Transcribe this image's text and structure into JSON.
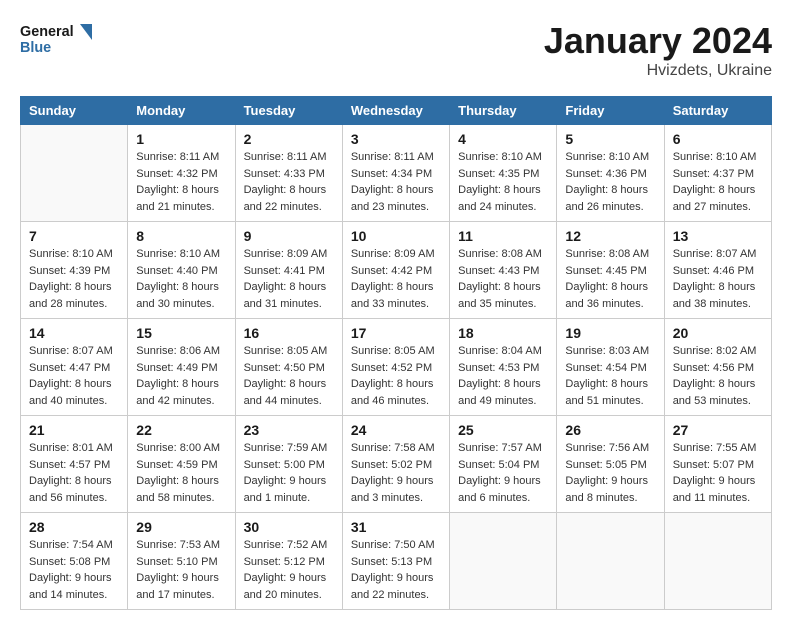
{
  "header": {
    "logo_line1": "General",
    "logo_line2": "Blue",
    "month": "January 2024",
    "location": "Hvizdets, Ukraine"
  },
  "weekdays": [
    "Sunday",
    "Monday",
    "Tuesday",
    "Wednesday",
    "Thursday",
    "Friday",
    "Saturday"
  ],
  "weeks": [
    [
      {
        "day": "",
        "sunrise": "",
        "sunset": "",
        "daylight": ""
      },
      {
        "day": "1",
        "sunrise": "Sunrise: 8:11 AM",
        "sunset": "Sunset: 4:32 PM",
        "daylight": "Daylight: 8 hours and 21 minutes."
      },
      {
        "day": "2",
        "sunrise": "Sunrise: 8:11 AM",
        "sunset": "Sunset: 4:33 PM",
        "daylight": "Daylight: 8 hours and 22 minutes."
      },
      {
        "day": "3",
        "sunrise": "Sunrise: 8:11 AM",
        "sunset": "Sunset: 4:34 PM",
        "daylight": "Daylight: 8 hours and 23 minutes."
      },
      {
        "day": "4",
        "sunrise": "Sunrise: 8:10 AM",
        "sunset": "Sunset: 4:35 PM",
        "daylight": "Daylight: 8 hours and 24 minutes."
      },
      {
        "day": "5",
        "sunrise": "Sunrise: 8:10 AM",
        "sunset": "Sunset: 4:36 PM",
        "daylight": "Daylight: 8 hours and 26 minutes."
      },
      {
        "day": "6",
        "sunrise": "Sunrise: 8:10 AM",
        "sunset": "Sunset: 4:37 PM",
        "daylight": "Daylight: 8 hours and 27 minutes."
      }
    ],
    [
      {
        "day": "7",
        "sunrise": "Sunrise: 8:10 AM",
        "sunset": "Sunset: 4:39 PM",
        "daylight": "Daylight: 8 hours and 28 minutes."
      },
      {
        "day": "8",
        "sunrise": "Sunrise: 8:10 AM",
        "sunset": "Sunset: 4:40 PM",
        "daylight": "Daylight: 8 hours and 30 minutes."
      },
      {
        "day": "9",
        "sunrise": "Sunrise: 8:09 AM",
        "sunset": "Sunset: 4:41 PM",
        "daylight": "Daylight: 8 hours and 31 minutes."
      },
      {
        "day": "10",
        "sunrise": "Sunrise: 8:09 AM",
        "sunset": "Sunset: 4:42 PM",
        "daylight": "Daylight: 8 hours and 33 minutes."
      },
      {
        "day": "11",
        "sunrise": "Sunrise: 8:08 AM",
        "sunset": "Sunset: 4:43 PM",
        "daylight": "Daylight: 8 hours and 35 minutes."
      },
      {
        "day": "12",
        "sunrise": "Sunrise: 8:08 AM",
        "sunset": "Sunset: 4:45 PM",
        "daylight": "Daylight: 8 hours and 36 minutes."
      },
      {
        "day": "13",
        "sunrise": "Sunrise: 8:07 AM",
        "sunset": "Sunset: 4:46 PM",
        "daylight": "Daylight: 8 hours and 38 minutes."
      }
    ],
    [
      {
        "day": "14",
        "sunrise": "Sunrise: 8:07 AM",
        "sunset": "Sunset: 4:47 PM",
        "daylight": "Daylight: 8 hours and 40 minutes."
      },
      {
        "day": "15",
        "sunrise": "Sunrise: 8:06 AM",
        "sunset": "Sunset: 4:49 PM",
        "daylight": "Daylight: 8 hours and 42 minutes."
      },
      {
        "day": "16",
        "sunrise": "Sunrise: 8:05 AM",
        "sunset": "Sunset: 4:50 PM",
        "daylight": "Daylight: 8 hours and 44 minutes."
      },
      {
        "day": "17",
        "sunrise": "Sunrise: 8:05 AM",
        "sunset": "Sunset: 4:52 PM",
        "daylight": "Daylight: 8 hours and 46 minutes."
      },
      {
        "day": "18",
        "sunrise": "Sunrise: 8:04 AM",
        "sunset": "Sunset: 4:53 PM",
        "daylight": "Daylight: 8 hours and 49 minutes."
      },
      {
        "day": "19",
        "sunrise": "Sunrise: 8:03 AM",
        "sunset": "Sunset: 4:54 PM",
        "daylight": "Daylight: 8 hours and 51 minutes."
      },
      {
        "day": "20",
        "sunrise": "Sunrise: 8:02 AM",
        "sunset": "Sunset: 4:56 PM",
        "daylight": "Daylight: 8 hours and 53 minutes."
      }
    ],
    [
      {
        "day": "21",
        "sunrise": "Sunrise: 8:01 AM",
        "sunset": "Sunset: 4:57 PM",
        "daylight": "Daylight: 8 hours and 56 minutes."
      },
      {
        "day": "22",
        "sunrise": "Sunrise: 8:00 AM",
        "sunset": "Sunset: 4:59 PM",
        "daylight": "Daylight: 8 hours and 58 minutes."
      },
      {
        "day": "23",
        "sunrise": "Sunrise: 7:59 AM",
        "sunset": "Sunset: 5:00 PM",
        "daylight": "Daylight: 9 hours and 1 minute."
      },
      {
        "day": "24",
        "sunrise": "Sunrise: 7:58 AM",
        "sunset": "Sunset: 5:02 PM",
        "daylight": "Daylight: 9 hours and 3 minutes."
      },
      {
        "day": "25",
        "sunrise": "Sunrise: 7:57 AM",
        "sunset": "Sunset: 5:04 PM",
        "daylight": "Daylight: 9 hours and 6 minutes."
      },
      {
        "day": "26",
        "sunrise": "Sunrise: 7:56 AM",
        "sunset": "Sunset: 5:05 PM",
        "daylight": "Daylight: 9 hours and 8 minutes."
      },
      {
        "day": "27",
        "sunrise": "Sunrise: 7:55 AM",
        "sunset": "Sunset: 5:07 PM",
        "daylight": "Daylight: 9 hours and 11 minutes."
      }
    ],
    [
      {
        "day": "28",
        "sunrise": "Sunrise: 7:54 AM",
        "sunset": "Sunset: 5:08 PM",
        "daylight": "Daylight: 9 hours and 14 minutes."
      },
      {
        "day": "29",
        "sunrise": "Sunrise: 7:53 AM",
        "sunset": "Sunset: 5:10 PM",
        "daylight": "Daylight: 9 hours and 17 minutes."
      },
      {
        "day": "30",
        "sunrise": "Sunrise: 7:52 AM",
        "sunset": "Sunset: 5:12 PM",
        "daylight": "Daylight: 9 hours and 20 minutes."
      },
      {
        "day": "31",
        "sunrise": "Sunrise: 7:50 AM",
        "sunset": "Sunset: 5:13 PM",
        "daylight": "Daylight: 9 hours and 22 minutes."
      },
      {
        "day": "",
        "sunrise": "",
        "sunset": "",
        "daylight": ""
      },
      {
        "day": "",
        "sunrise": "",
        "sunset": "",
        "daylight": ""
      },
      {
        "day": "",
        "sunrise": "",
        "sunset": "",
        "daylight": ""
      }
    ]
  ]
}
